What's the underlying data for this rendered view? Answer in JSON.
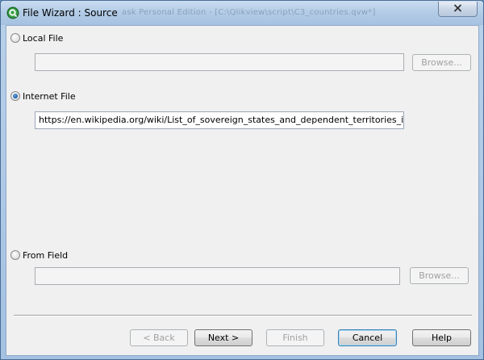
{
  "window": {
    "title": "File Wizard : Source",
    "background_title_ghost": "ask Personal Edition    - [C:\\Qlikview\\script\\C3_countries.qvw*]",
    "close_symbol": "✕"
  },
  "source_options": {
    "local_file": {
      "label": "Local File",
      "selected": false,
      "path_value": "",
      "browse_label": "Browse..."
    },
    "internet_file": {
      "label": "Internet File",
      "selected": true,
      "url_value": "https://en.wikipedia.org/wiki/List_of_sovereign_states_and_dependent_territories_in_Asia"
    },
    "from_field": {
      "label": "From Field",
      "selected": false,
      "field_value": "",
      "browse_label": "Browse..."
    }
  },
  "footer": {
    "back_label": "< Back",
    "next_label": "Next >",
    "finish_label": "Finish",
    "cancel_label": "Cancel",
    "help_label": "Help"
  },
  "icons": {
    "app": "qlikview-app-icon",
    "close": "close-icon"
  },
  "colors": {
    "title_bar": "#b2cbe6",
    "client_bg": "#f0f0f0",
    "radio_accent": "#1f5fa8"
  }
}
